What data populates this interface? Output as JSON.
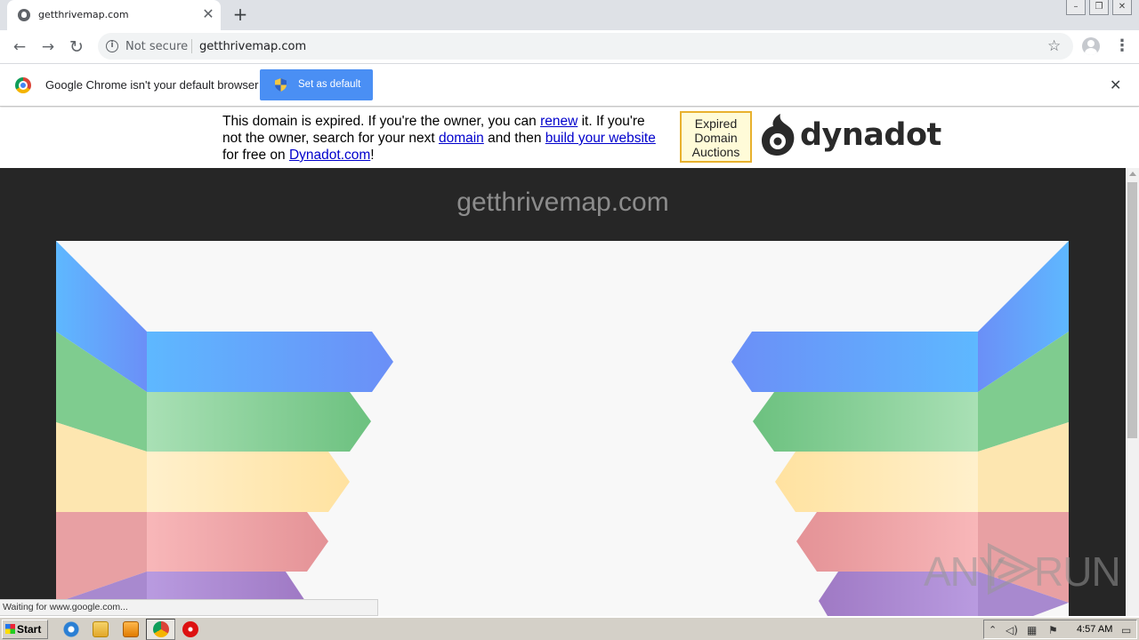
{
  "browser": {
    "tab": {
      "title": "getthrivemap.com",
      "close_label": "✕"
    },
    "new_tab_label": "+",
    "window_buttons": {
      "minimize": "–",
      "restore": "❐",
      "close": "✕"
    },
    "toolbar": {
      "back": "←",
      "forward": "→",
      "reload": "↻",
      "security_label": "Not secure",
      "url": "getthrivemap.com",
      "bookmark": "☆",
      "menu": "⋮"
    },
    "infobar": {
      "message": "Google Chrome isn't your default browser",
      "button_label": "Set as default",
      "close": "✕"
    }
  },
  "page": {
    "banner": {
      "t1": "This domain is expired. If you're the owner, you can ",
      "link_renew": "renew",
      "t2": " it. If you're not the owner, search for your next ",
      "link_domain": "domain",
      "t3": " and then ",
      "link_build": "build your website",
      "t4": " for free on ",
      "link_dynadot": "Dynadot.com",
      "t5": "!"
    },
    "expired_auctions": {
      "l1": "Expired",
      "l2": "Domain",
      "l3": "Auctions"
    },
    "brand": "dynadot",
    "domain_heading": "getthrivemap.com",
    "art_colors": {
      "blue": "#6b8ff7",
      "green": "#6cc17f",
      "yellow": "#ffe2a0",
      "red": "#e49296",
      "purple": "#9f79c4"
    }
  },
  "status_text": "Waiting for www.google.com...",
  "watermark": {
    "left": "ANY",
    "right": "RUN"
  },
  "taskbar": {
    "start_label": "Start",
    "clock": "4:57 AM"
  }
}
